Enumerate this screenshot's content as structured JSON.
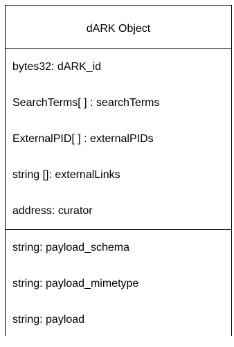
{
  "class": {
    "name": "dARK Object",
    "attributes": [
      "bytes32: dARK_id",
      "SearchTerms[ ] : searchTerms",
      "ExternalPID[ ] : externalPIDs",
      "string []: externalLinks",
      "address: curator"
    ],
    "payload_fields": [
      "string: payload_schema",
      "string: payload_mimetype",
      "string: payload"
    ]
  }
}
